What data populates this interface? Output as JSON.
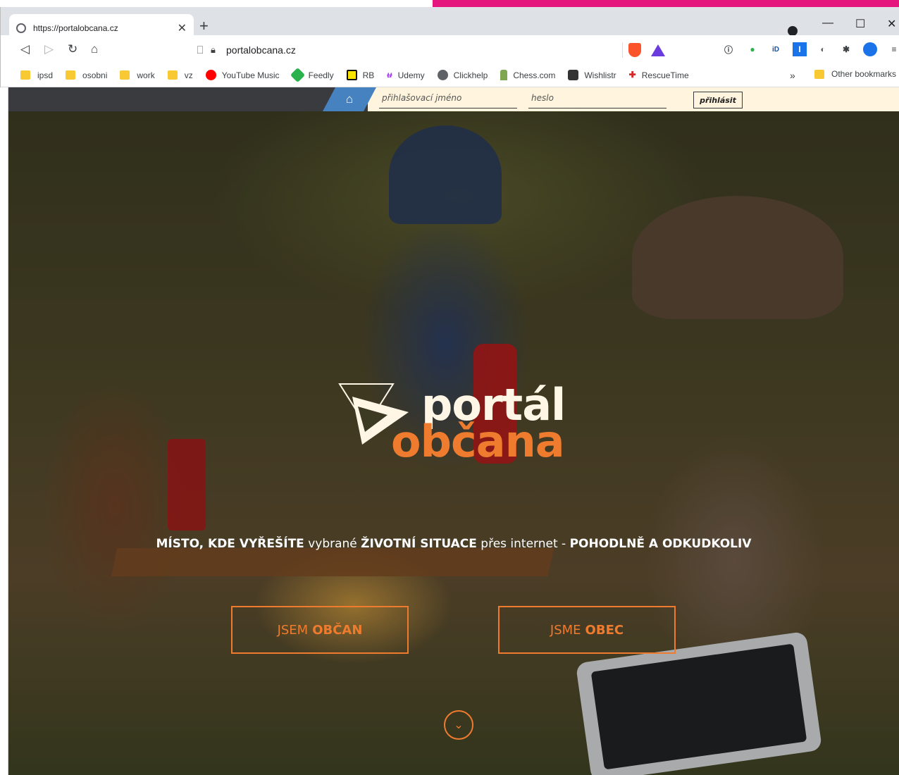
{
  "browser": {
    "tab_title": "https://portalobcana.cz",
    "url": "portalobcana.cz",
    "bookmarks": [
      {
        "label": "ipsd",
        "type": "folder"
      },
      {
        "label": "osobni",
        "type": "folder"
      },
      {
        "label": "work",
        "type": "folder"
      },
      {
        "label": "vz",
        "type": "folder"
      },
      {
        "label": "YouTube Music",
        "type": "site",
        "color": "#ff0000"
      },
      {
        "label": "Feedly",
        "type": "site",
        "color": "#2bb24c"
      },
      {
        "label": "RB",
        "type": "site",
        "color": "#f9e400"
      },
      {
        "label": "Udemy",
        "type": "site",
        "color": "#a435f0"
      },
      {
        "label": "Clickhelp",
        "type": "site",
        "color": "#5f6368"
      },
      {
        "label": "Chess.com",
        "type": "site",
        "color": "#7fa650"
      },
      {
        "label": "Wishlistr",
        "type": "site",
        "color": "#333333"
      },
      {
        "label": "RescueTime",
        "type": "site",
        "color": "#d62828"
      }
    ],
    "bookmarks_more": "»",
    "other_bookmarks": "Other bookmarks"
  },
  "site": {
    "login_placeholder": "přihlašovací jméno",
    "password_placeholder": "heslo",
    "login_button": "přihlásit",
    "logo_line1": "portál",
    "logo_line2": "občana",
    "tagline": {
      "p1": "MÍSTO, KDE VYŘEŠÍTE",
      "p2": " vybrané ",
      "p3": "ŽIVOTNÍ SITUACE",
      "p4": " přes internet - ",
      "p5": "POHODLNĚ A ODKUDKOLIV"
    },
    "cta_citizen_pre": "JSEM",
    "cta_citizen_bold": "OBČAN",
    "cta_town_pre": "JSME",
    "cta_town_bold": "OBEC",
    "accent_color": "#ef7c2e",
    "header_dark_color": "#3a3b3e",
    "home_tab_color": "#4682bf"
  }
}
